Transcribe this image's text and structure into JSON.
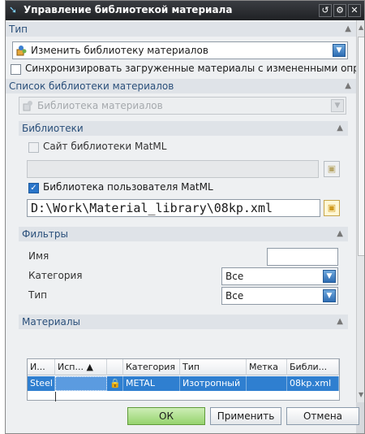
{
  "window": {
    "title": "Управление библиотекой материала",
    "icon": "arrow-cursor-icon",
    "controls": {
      "reset": "↺",
      "settings": "⚙",
      "close": "✕"
    }
  },
  "sections": {
    "type": {
      "header": "Тип",
      "selected": "Изменить библиотеку материалов"
    },
    "sync_checkbox": {
      "label": "Синхронизировать загруженные материалы с измененными опре,",
      "checked": false
    },
    "library_list": {
      "header": "Список библиотеки материалов",
      "selected": "Библиотека материалов"
    },
    "libraries": {
      "header": "Библиотеки",
      "matml_site_label": "Сайт библиотеки MatML",
      "matml_site_checked": false,
      "matml_site_value": "",
      "user_matml_label": "Библиотека пользователя MatML",
      "user_matml_checked": true,
      "user_matml_path": "D:\\Work\\Material_library\\08kp.xml"
    },
    "filters": {
      "header": "Фильтры",
      "name_label": "Имя",
      "name_value": "",
      "category_label": "Категория",
      "category_value": "Все",
      "type_label": "Тип",
      "type_value": "Все"
    },
    "materials": {
      "header": "Материалы",
      "columns": [
        "И...",
        "Исп... ▲",
        "",
        "Категория",
        "Тип",
        "Метка",
        "Библи..."
      ],
      "rows": [
        [
          "Steel",
          "",
          "",
          "METAL",
          "Изотропный",
          "",
          "08kp.xml"
        ]
      ]
    }
  },
  "buttons": {
    "ok": "ОК",
    "apply": "Применить",
    "cancel": "Отмена"
  },
  "colors": {
    "accent": "#2f7fd0",
    "header_text": "#2a4f7a",
    "ok_button": "#96d36e"
  }
}
